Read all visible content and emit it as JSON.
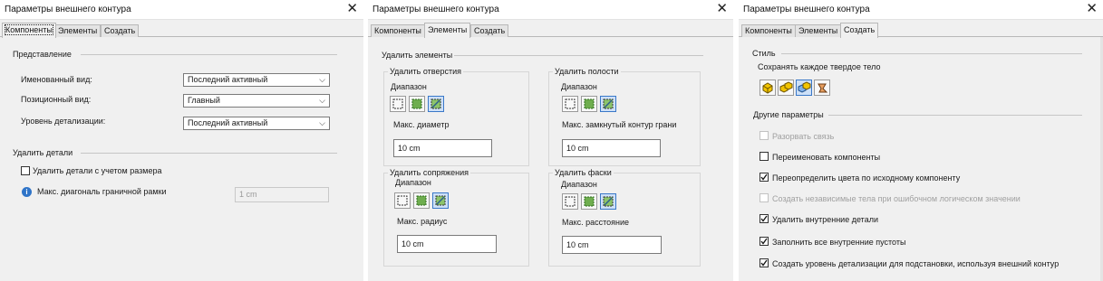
{
  "dialog_title": "Параметры внешнего контура",
  "tabs": [
    "Компоненты",
    "Элементы",
    "Создать"
  ],
  "panel1": {
    "representation_heading": "Представление",
    "rows": [
      {
        "label": "Именованный вид:",
        "value": "Последний активный"
      },
      {
        "label": "Позиционный вид:",
        "value": "Главный"
      },
      {
        "label": "Уровень детализации:",
        "value": "Последний активный"
      }
    ],
    "remove_details_heading": "Удалить детали",
    "remove_by_size_label": "Удалить детали с учетом размера",
    "max_diagonal_label": "Макс. диагональ граничной рамки",
    "max_diagonal_value": "1 cm"
  },
  "panel2": {
    "remove_features_heading": "Удалить элементы",
    "groups": [
      {
        "title": "Удалить отверстия",
        "range_label": "Диапазон",
        "param_label": "Макс. диаметр",
        "value": "10 cm"
      },
      {
        "title": "Удалить полости",
        "range_label": "Диапазон",
        "param_label": "Макс. замкнутый контур грани",
        "value": "10 cm"
      },
      {
        "title": "Удалить сопряжения",
        "range_label": "Диапазон",
        "param_label": "Макс. радиус",
        "value": "10 cm"
      },
      {
        "title": "Удалить фаски",
        "range_label": "Диапазон",
        "param_label": "Макс. расстояние",
        "value": "10 cm"
      }
    ]
  },
  "panel3": {
    "style_heading": "Стиль",
    "style_caption": "Сохранять каждое твердое тело",
    "other_heading": "Другие параметры",
    "options": [
      {
        "label": "Разорвать связь",
        "checked": false,
        "disabled": true
      },
      {
        "label": "Переименовать компоненты",
        "checked": false,
        "disabled": false
      },
      {
        "label": "Переопределить цвета по исходному компоненту",
        "checked": true,
        "disabled": false
      },
      {
        "label": "Создать независимые тела при ошибочном логическом значении",
        "checked": false,
        "disabled": true
      },
      {
        "label": "Удалить внутренние детали",
        "checked": true,
        "disabled": false
      },
      {
        "label": "Заполнить все внутренние пустоты",
        "checked": true,
        "disabled": false
      },
      {
        "label": "Создать уровень детализации для подстановки, используя внешний контур",
        "checked": true,
        "disabled": false
      }
    ]
  },
  "close_glyph": "✕",
  "chevron_glyph": "⌵",
  "info_glyph": "i",
  "colors": {
    "accent": "#2f74c8",
    "green": "#4e9a3a",
    "yellow": "#f2c400"
  }
}
